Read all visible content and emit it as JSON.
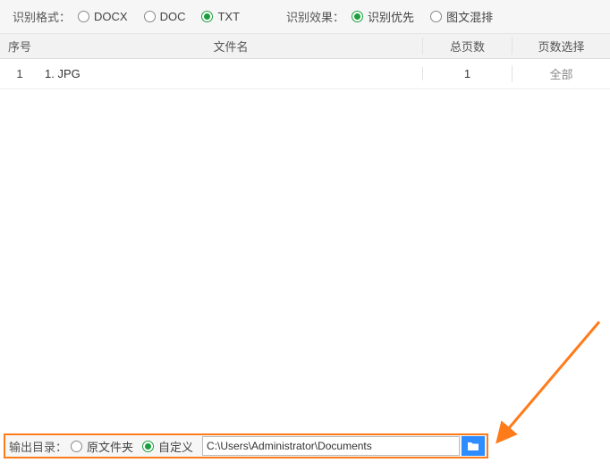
{
  "options": {
    "format_label": "识别格式：",
    "format_items": [
      {
        "label": "DOCX",
        "selected": false
      },
      {
        "label": "DOC",
        "selected": false
      },
      {
        "label": "TXT",
        "selected": true
      }
    ],
    "effect_label": "识别效果：",
    "effect_items": [
      {
        "label": "识别优先",
        "selected": true
      },
      {
        "label": "图文混排",
        "selected": false
      }
    ]
  },
  "table": {
    "headers": {
      "seq": "序号",
      "file": "文件名",
      "pages": "总页数",
      "select": "页数选择"
    },
    "rows": [
      {
        "seq": "1",
        "file": "1. JPG",
        "pages": "1",
        "select": "全部"
      }
    ]
  },
  "output": {
    "label": "输出目录：",
    "items": [
      {
        "label": "原文件夹",
        "selected": false
      },
      {
        "label": "自定义",
        "selected": true
      }
    ],
    "path": "C:\\Users\\Administrator\\Documents"
  },
  "colors": {
    "accent_green": "#1a9f3c",
    "highlight_orange": "#ff7b1a",
    "browse_blue": "#2d8cff"
  }
}
